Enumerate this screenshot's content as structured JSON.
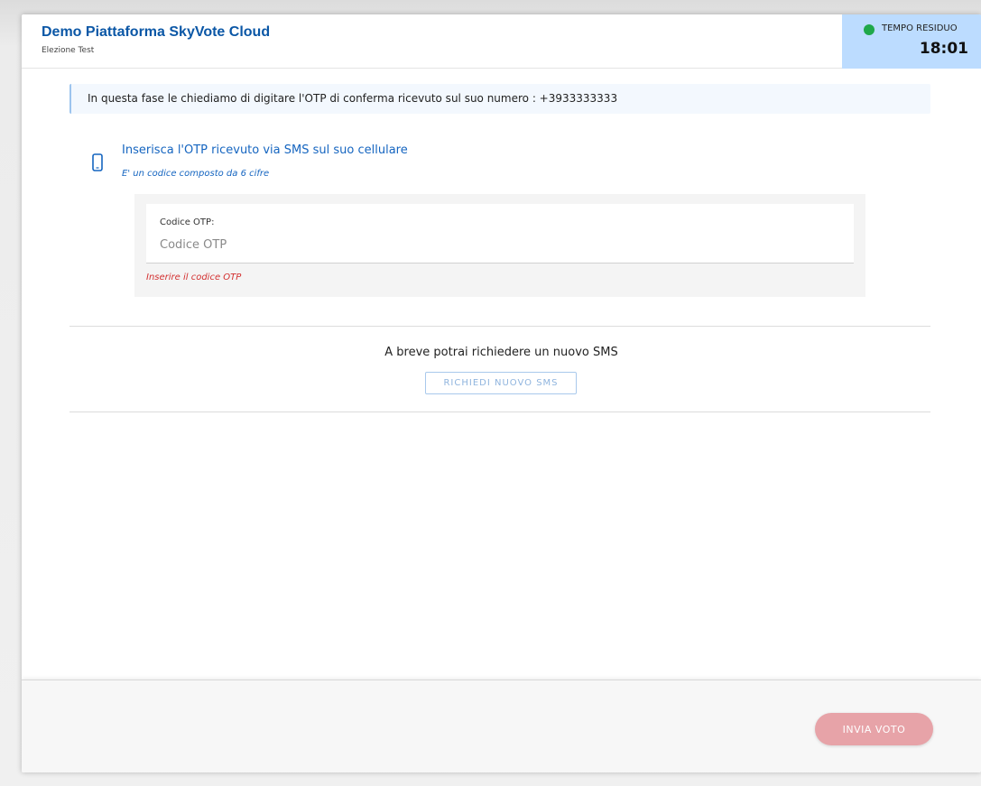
{
  "header": {
    "title": "Demo Piattaforma SkyVote Cloud",
    "subtitle": "Elezione Test"
  },
  "timer": {
    "label": "TEMPO RESIDUO",
    "value": "18:01",
    "status_color": "#1fa84a"
  },
  "info_bar": {
    "text": "In questa fase le chiediamo di digitare l'OTP di conferma ricevuto sul suo numero : +3933333333"
  },
  "otp": {
    "icon": "mobile-phone-icon",
    "heading": "Inserisca l'OTP ricevuto via SMS sul suo cellulare",
    "hint": "E' un codice composto da 6 cifre",
    "field_label": "Codice OTP:",
    "placeholder": "Codice OTP",
    "value": "",
    "error": "Inserire il codice OTP"
  },
  "sms": {
    "text": "A breve potrai richiedere un nuovo SMS",
    "button_label": "RICHIEDI NUOVO SMS"
  },
  "footer": {
    "submit_label": "INVIA VOTO"
  },
  "colors": {
    "accent": "#0b57a6",
    "link": "#1565c0",
    "error": "#d32f2f",
    "timer_bg": "#bcdcff",
    "submit_disabled": "#e7a3a8"
  }
}
